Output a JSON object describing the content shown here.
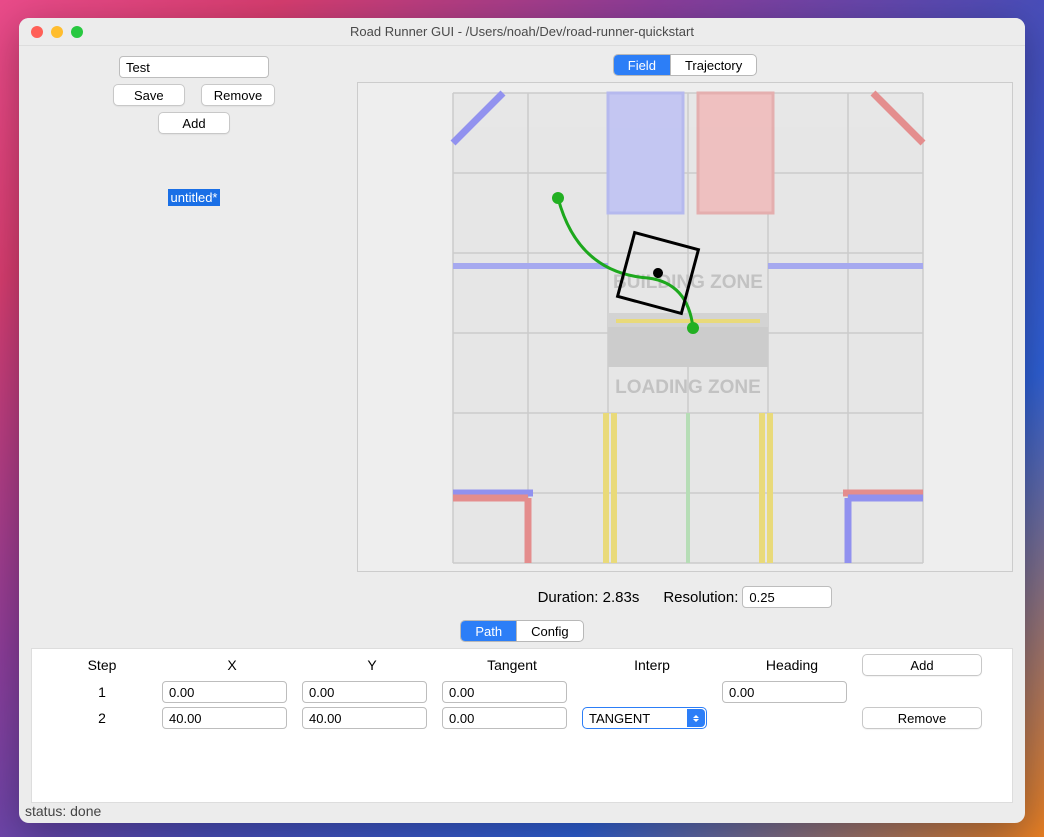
{
  "window": {
    "title": "Road Runner GUI - /Users/noah/Dev/road-runner-quickstart"
  },
  "left": {
    "name_value": "Test",
    "save_label": "Save",
    "remove_label": "Remove",
    "add_label": "Add",
    "file_label": "untitled*"
  },
  "view_tabs": {
    "field": "Field",
    "trajectory": "Trajectory"
  },
  "field_labels": {
    "building_zone": "BUILDING ZONE",
    "loading_zone": "LOADING ZONE"
  },
  "duration_label": "Duration:",
  "duration_value": "2.83s",
  "resolution_label": "Resolution:",
  "resolution_value": "0.25",
  "bottom_tabs": {
    "path": "Path",
    "config": "Config"
  },
  "table": {
    "headers": {
      "step": "Step",
      "x": "X",
      "y": "Y",
      "tangent": "Tangent",
      "interp": "Interp",
      "heading": "Heading"
    },
    "add_label": "Add",
    "remove_label": "Remove",
    "rows": [
      {
        "step": "1",
        "x": "0.00",
        "y": "0.00",
        "tangent": "0.00",
        "interp": "",
        "heading": "0.00"
      },
      {
        "step": "2",
        "x": "40.00",
        "y": "40.00",
        "tangent": "0.00",
        "interp": "TANGENT",
        "heading": ""
      }
    ]
  },
  "status_text": "status: done"
}
